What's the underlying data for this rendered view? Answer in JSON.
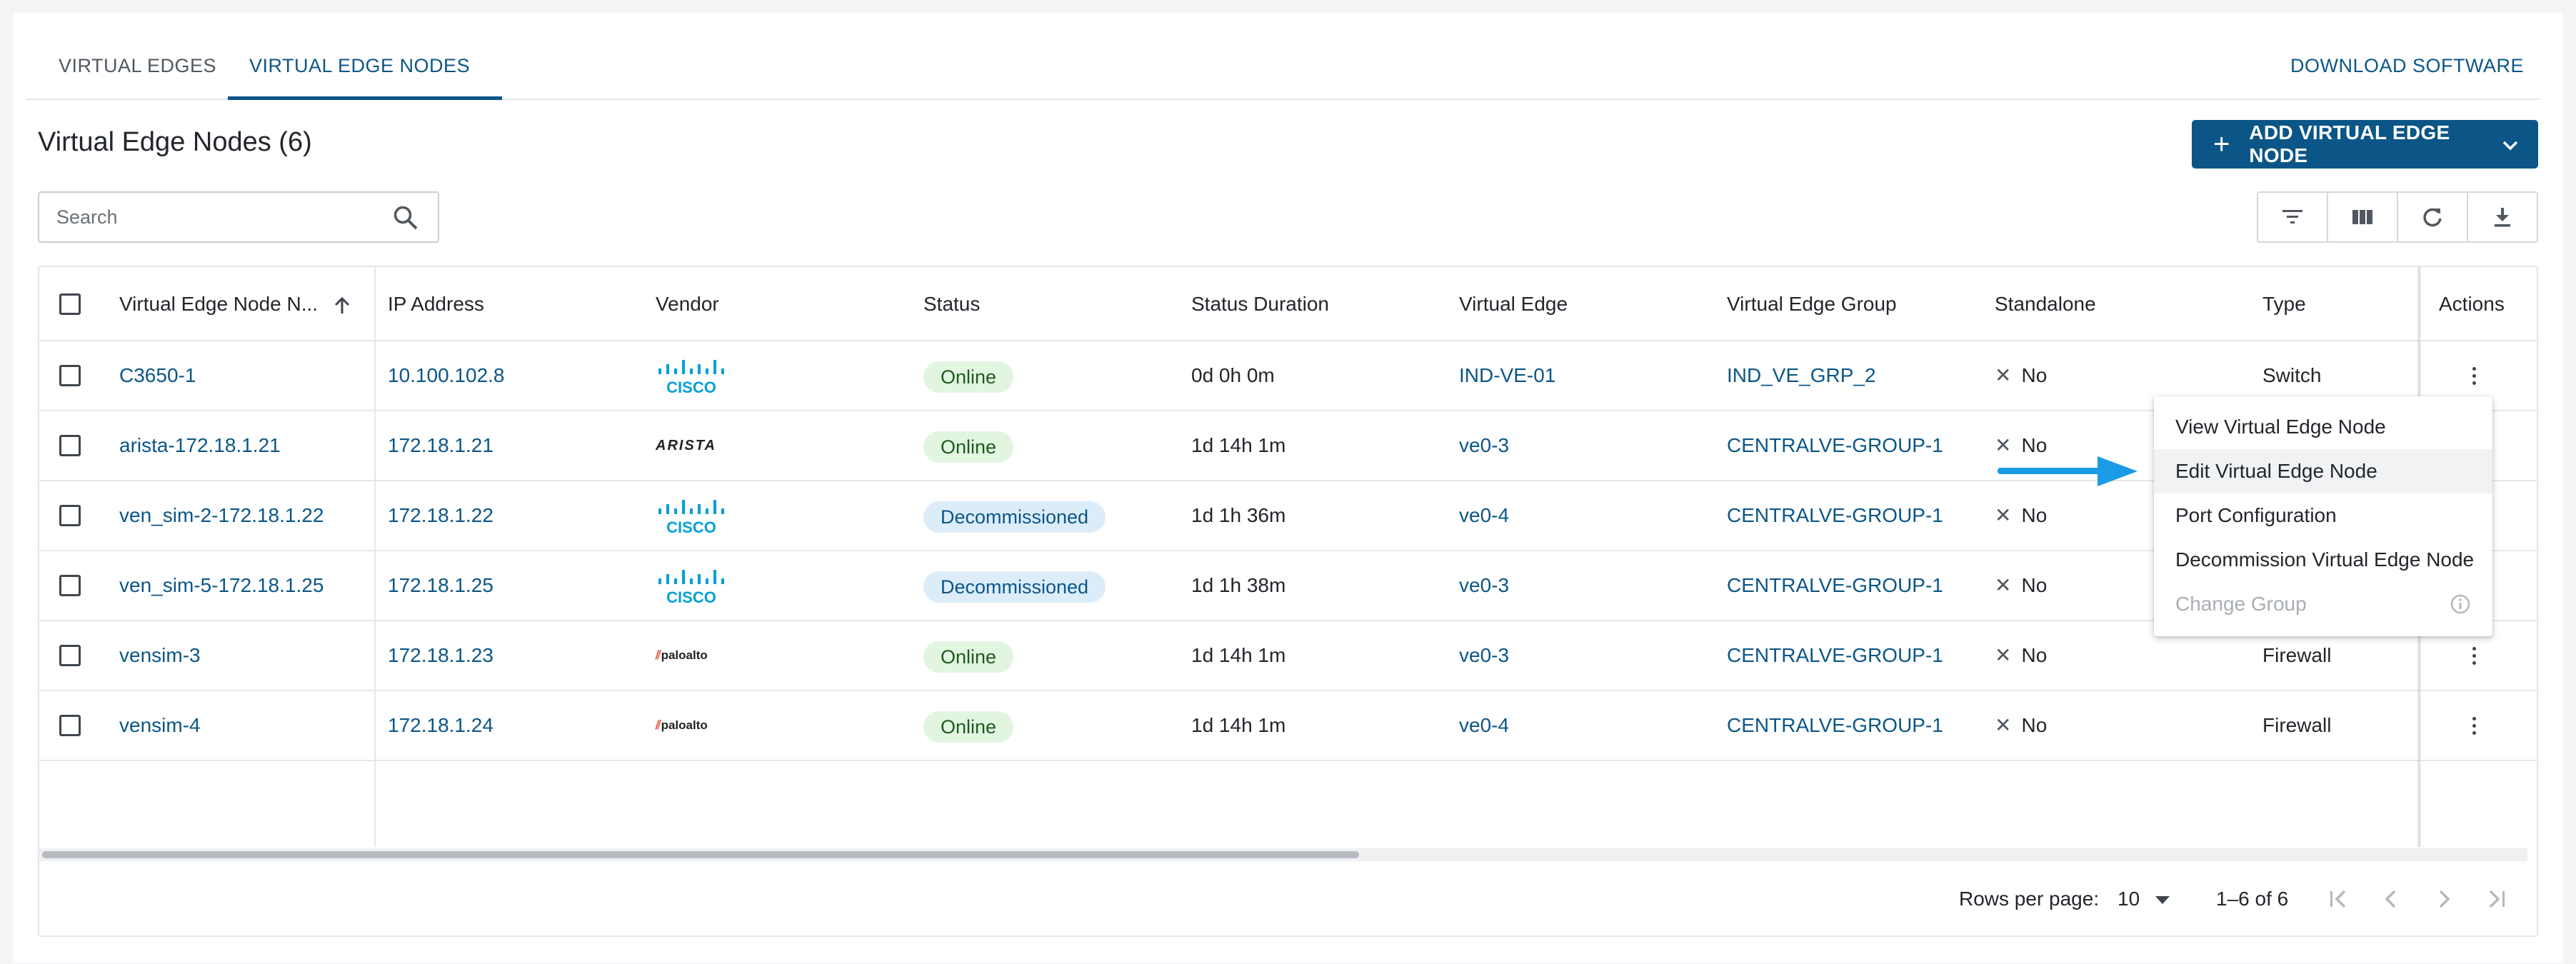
{
  "tabs": [
    {
      "label": "VIRTUAL EDGES",
      "active": false
    },
    {
      "label": "VIRTUAL EDGE NODES",
      "active": true
    }
  ],
  "download_label": "DOWNLOAD SOFTWARE",
  "page_title": "Virtual Edge Nodes (6)",
  "add_button_label": "ADD VIRTUAL EDGE NODE",
  "search": {
    "placeholder": "Search",
    "value": ""
  },
  "toolbar": {
    "icons": [
      "filter-icon",
      "columns-icon",
      "refresh-icon",
      "download-icon"
    ]
  },
  "table": {
    "headers": {
      "name": "Virtual Edge Node N...",
      "ip": "IP Address",
      "vendor": "Vendor",
      "status": "Status",
      "duration": "Status Duration",
      "ve": "Virtual Edge",
      "veg": "Virtual Edge Group",
      "standalone": "Standalone",
      "type": "Type",
      "actions": "Actions"
    },
    "rows": [
      {
        "name": "C3650-1",
        "ip": "10.100.102.8",
        "vendor": "CISCO",
        "status": "Online",
        "duration": "0d 0h 0m",
        "ve": "IND-VE-01",
        "veg": "IND_VE_GRP_2",
        "standalone": "No",
        "type": "Switch"
      },
      {
        "name": "arista-172.18.1.21",
        "ip": "172.18.1.21",
        "vendor": "ARISTA",
        "status": "Online",
        "duration": "1d 14h 1m",
        "ve": "ve0-3",
        "veg": "CENTRALVE-GROUP-1",
        "standalone": "No",
        "type": ""
      },
      {
        "name": "ven_sim-2-172.18.1.22",
        "ip": "172.18.1.22",
        "vendor": "CISCO",
        "status": "Decommissioned",
        "duration": "1d 1h 36m",
        "ve": "ve0-4",
        "veg": "CENTRALVE-GROUP-1",
        "standalone": "No",
        "type": ""
      },
      {
        "name": "ven_sim-5-172.18.1.25",
        "ip": "172.18.1.25",
        "vendor": "CISCO",
        "status": "Decommissioned",
        "duration": "1d 1h 38m",
        "ve": "ve0-3",
        "veg": "CENTRALVE-GROUP-1",
        "standalone": "No",
        "type": ""
      },
      {
        "name": "vensim-3",
        "ip": "172.18.1.23",
        "vendor": "paloalto",
        "status": "Online",
        "duration": "1d 14h 1m",
        "ve": "ve0-3",
        "veg": "CENTRALVE-GROUP-1",
        "standalone": "No",
        "type": "Firewall"
      },
      {
        "name": "vensim-4",
        "ip": "172.18.1.24",
        "vendor": "paloalto",
        "status": "Online",
        "duration": "1d 14h 1m",
        "ve": "ve0-4",
        "veg": "CENTRALVE-GROUP-1",
        "standalone": "No",
        "type": "Firewall"
      }
    ]
  },
  "footer": {
    "rows_per_page_label": "Rows per page:",
    "rows_per_page_value": "10",
    "range": "1–6 of 6"
  },
  "context_menu": [
    {
      "label": "View Virtual Edge Node",
      "state": "normal"
    },
    {
      "label": "Edit Virtual Edge Node",
      "state": "hover"
    },
    {
      "label": "Port Configuration",
      "state": "normal"
    },
    {
      "label": "Decommission Virtual Edge Node",
      "state": "normal"
    },
    {
      "label": "Change Group",
      "state": "disabled"
    }
  ],
  "colors": {
    "accent": "#0b5687",
    "online_bg": "#e2f5e1",
    "decom_bg": "#dcedf9",
    "arrow": "#1a9be6",
    "cisco": "#049fd9"
  }
}
